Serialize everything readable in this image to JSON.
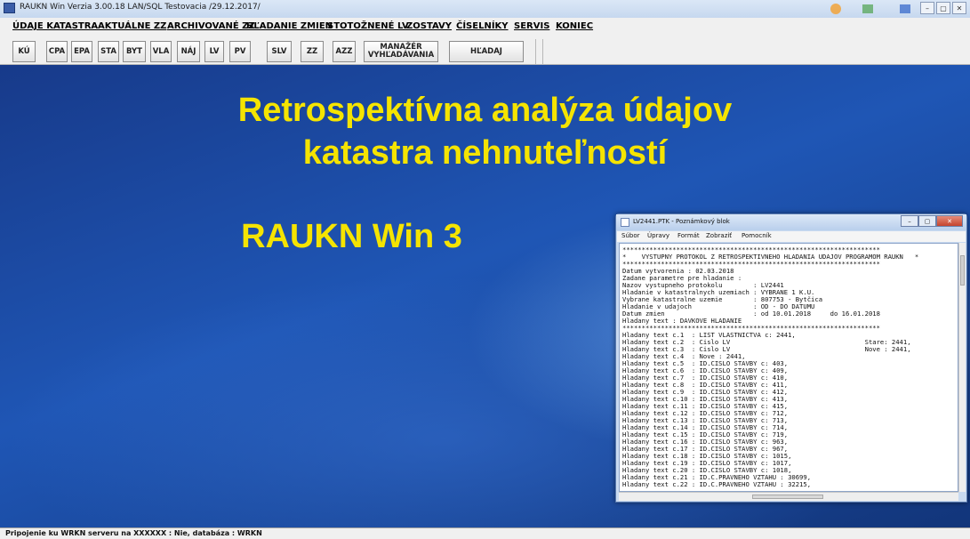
{
  "window": {
    "title": "RAUKN Win Verzia 3.00.18 LAN/SQL Testovacia /29.12.2017/",
    "buttons": [
      "–",
      "▢",
      "✕"
    ]
  },
  "menu": [
    "ÚDAJE KATASTRA",
    "AKTUÁLNE ZZ",
    "ARCHIVOVANÉ ZZ",
    "HĽADANIE ZMIEN",
    "STOTOŽNENÉ LV",
    "ZOSTAVY",
    "ČÍSELNÍKY",
    "SERVIS",
    "KONIEC"
  ],
  "toolbar": {
    "ku": "KÚ",
    "cpa": "CPA",
    "epa": "EPA",
    "sta": "STA",
    "byt": "BYT",
    "vla": "VLA",
    "naj": "NÁJ",
    "lv": "LV",
    "pv": "PV",
    "slv": "SLV",
    "zz": "ZZ",
    "azz": "AZZ",
    "manazer_line1": "MANAŽÉR",
    "manazer_line2": "VYHĽADÁVANIA",
    "hladaj": "HĽADAJ"
  },
  "splash": {
    "line1": "Retrospektívna analýza údajov",
    "line2": "katastra nehnuteľností",
    "line3": "RAUKN Win 3"
  },
  "notepad": {
    "title": "LV2441.PTK - Poznámkový blok",
    "buttons": [
      "–",
      "▢",
      "✕"
    ],
    "menu": [
      "Súbor",
      "Úpravy",
      "Formát",
      "Zobraziť",
      "Pomocník"
    ],
    "lines": [
      "*******************************************************************",
      "*    VYSTUPNY PROTOKOL Z RETROSPEKTIVNEHO HLADANIA UDAJOV PROGRAMOM RAUKN   *",
      "*******************************************************************",
      "Datum vytvorenia : 02.03.2018",
      "Zadane parametre pre hladanie :",
      "Nazov vystupneho protokolu        : LV2441",
      "Hladanie v katastralnych uzemiach : VYBRANE 1 K.U.",
      "Vybrane katastralne uzemie        : 807753 - Bytčica",
      "Hladanie v udajoch                : OD - DO DATUMU",
      "Datum zmien                       : od 10.01.2018     do 16.01.2018",
      "Hladany text : DAVKOVE HLADANIE",
      "*******************************************************************",
      "Hladany text c.1  : LIST VLASTNICTVA c: 2441,",
      "Hladany text c.2  : Cislo LV                                   Stare: 2441,",
      "Hladany text c.3  : Cislo LV                                   Nove : 2441,",
      "Hladany text c.4  : Nove : 2441,",
      "Hladany text c.5  : ID.CISLO STAVBY c: 403,",
      "Hladany text c.6  : ID.CISLO STAVBY c: 409,",
      "Hladany text c.7  : ID.CISLO STAVBY c: 410,",
      "Hladany text c.8  : ID.CISLO STAVBY c: 411,",
      "Hladany text c.9  : ID.CISLO STAVBY c: 412,",
      "Hladany text c.10 : ID.CISLO STAVBY c: 413,",
      "Hladany text c.11 : ID.CISLO STAVBY c: 415,",
      "Hladany text c.12 : ID.CISLO STAVBY c: 712,",
      "Hladany text c.13 : ID.CISLO STAVBY c: 713,",
      "Hladany text c.14 : ID.CISLO STAVBY c: 714,",
      "Hladany text c.15 : ID.CISLO STAVBY c: 719,",
      "Hladany text c.16 : ID.CISLO STAVBY c: 963,",
      "Hladany text c.17 : ID.CISLO STAVBY c: 967,",
      "Hladany text c.18 : ID.CISLO STAVBY c: 1015,",
      "Hladany text c.19 : ID.CISLO STAVBY c: 1017,",
      "Hladany text c.20 : ID.CISLO STAVBY c: 1018,",
      "Hladany text c.21 : ID.C.PRAVNEHO VZTAHU : 30699,",
      "Hladany text c.22 : ID.C.PRAVNEHO VZTAHU : 32215,"
    ]
  },
  "status": "Pripojenie ku WRKN serveru na XXXXXX : Nie, databáza : WRKN",
  "colors": {
    "headline": "#f5e400",
    "desktop": "#1b3f8a"
  }
}
